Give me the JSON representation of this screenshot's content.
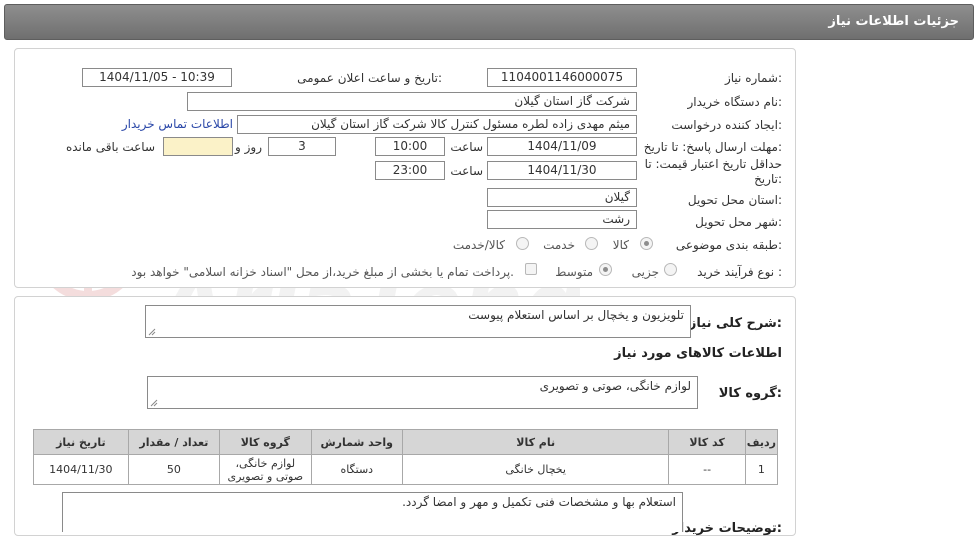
{
  "header": {
    "title": "جزئیات اطلاعات نیاز"
  },
  "form": {
    "need_number_label": "شماره نیاز:",
    "need_number": "1104001146000075",
    "announce_label": "تاریخ و ساعت اعلان عمومی:",
    "announce_value": "1404/11/05 - 10:39",
    "buyer_label": "نام دستگاه خریدار:",
    "buyer_value": "شرکت گاز استان گیلان",
    "creator_label": "ایجاد کننده درخواست:",
    "creator_value": "میثم مهدی زاده لطره مسئول کنترل کالا شرکت گاز استان گیلان",
    "contact_link": "اطلاعات تماس خریدار",
    "deadline_label": "مهلت ارسال پاسخ: تا تاریخ:",
    "deadline_date": "1404/11/09",
    "time_label": "ساعت",
    "deadline_time": "10:00",
    "days_value": "3",
    "days_label": "روز و",
    "remaining_value": "",
    "remaining_label": "ساعت باقی مانده",
    "validity_label_1": "حداقل تاریخ اعتبار قیمت: تا",
    "validity_label_2": "تاریخ:",
    "validity_date": "1404/11/30",
    "validity_time": "23:00",
    "province_label": "استان محل تحویل:",
    "province_value": "گیلان",
    "city_label": "شهر محل تحویل:",
    "city_value": "رشت",
    "category_label": "طبقه بندی موضوعی:",
    "category_options": [
      "کالا",
      "خدمت",
      "کالا/خدمت"
    ],
    "process_label": "نوع فرآیند خرید :",
    "process_options": [
      "جزیی",
      "متوسط"
    ],
    "payment_note": "پرداخت تمام یا بخشی از مبلغ خرید،از محل \"اسناد خزانه اسلامی\" خواهد بود."
  },
  "summary": {
    "desc_label": "شرح کلی نیاز:",
    "desc_value": "تلویزیون و یخچال بر اساس استعلام پیوست",
    "goods_info_title": "اطلاعات کالاهای مورد نیاز",
    "group_label": "گروه کالا:",
    "group_value": "لوازم خانگی، صوتی و تصویری"
  },
  "table": {
    "headers": [
      "ردیف",
      "کد کالا",
      "نام کالا",
      "واحد شمارش",
      "گروه کالا",
      "تعداد / مقدار",
      "تاریخ نیاز"
    ],
    "rows": [
      {
        "row": "1",
        "code": "--",
        "name": "یخچال خانگی",
        "unit": "دستگاه",
        "group_line1": "لوازم خانگی،",
        "group_line2": "صوتی و تصویری",
        "qty": "50",
        "date": "1404/11/30"
      }
    ]
  },
  "notes": {
    "label": "توضیحات خریدار:",
    "value": "استعلام بها و مشخصات فنی تکمیل و مهر و امضا گردد."
  }
}
